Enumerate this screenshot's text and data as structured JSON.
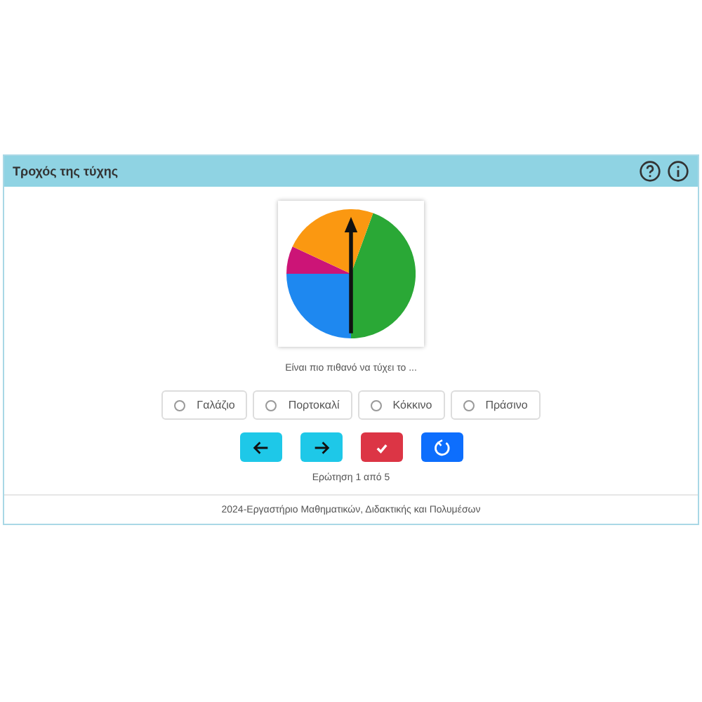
{
  "window": {
    "title": "Τροχός της τύχης"
  },
  "question": "Είναι πιο πιθανό να τύχει το ...",
  "options": [
    {
      "label": "Γαλάζιο",
      "selected": false
    },
    {
      "label": "Πορτοκαλί",
      "selected": false
    },
    {
      "label": "Κόκκινο",
      "selected": false
    },
    {
      "label": "Πράσινο",
      "selected": false
    }
  ],
  "buttons": [
    {
      "kind": "back"
    },
    {
      "kind": "next"
    },
    {
      "kind": "check"
    },
    {
      "kind": "restart"
    }
  ],
  "progress": "Ερώτηση 1 από 5",
  "footer": "2024-Εργαστήριο Μαθηματικών, Διδακτικής και Πολυμέσων"
}
